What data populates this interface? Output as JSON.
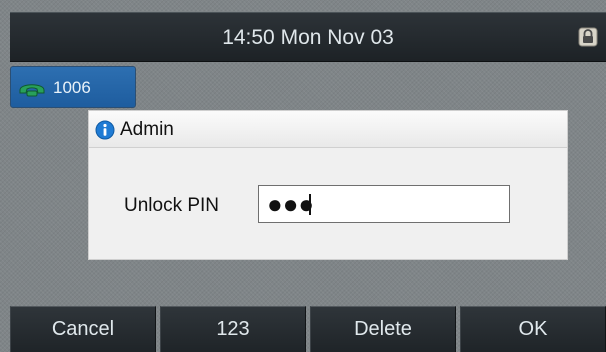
{
  "status_bar": {
    "time_date": "14:50 Mon Nov 03",
    "lock_icon": "lock-icon"
  },
  "line_key": {
    "label": "1006",
    "icon": "phone-handset-icon",
    "icon_color": "#28a05a"
  },
  "dialog": {
    "title": "Admin",
    "icon": "info-icon",
    "pin_label": "Unlock PIN",
    "pin_value_masked": "●●●"
  },
  "softkeys": [
    "Cancel",
    "123",
    "Delete",
    "OK"
  ],
  "colors": {
    "accent_blue": "#1e5d9f",
    "info_blue": "#1f7bd4"
  }
}
